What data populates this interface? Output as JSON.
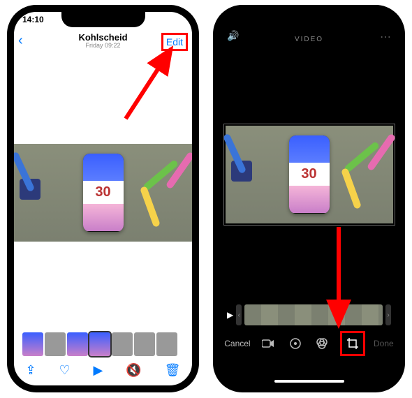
{
  "left": {
    "time": "14:10",
    "title": "Kohlscheid",
    "subtitle": "Friday  09:22",
    "edit": "Edit",
    "photo_number": "30"
  },
  "right": {
    "header": "VIDEO",
    "cancel": "Cancel",
    "done": "Done",
    "photo_number": "30"
  },
  "icons": {
    "back": "‹",
    "share": "⇪",
    "heart": "♡",
    "play": "▶",
    "mute": "🔇",
    "trash": "🗑",
    "volume": "🔊",
    "more": "⋯",
    "play_small": "▶",
    "handle_l": "‹",
    "handle_r": "›",
    "video": "■",
    "adjust": "◑",
    "filters": "●",
    "crop": "⌗"
  }
}
